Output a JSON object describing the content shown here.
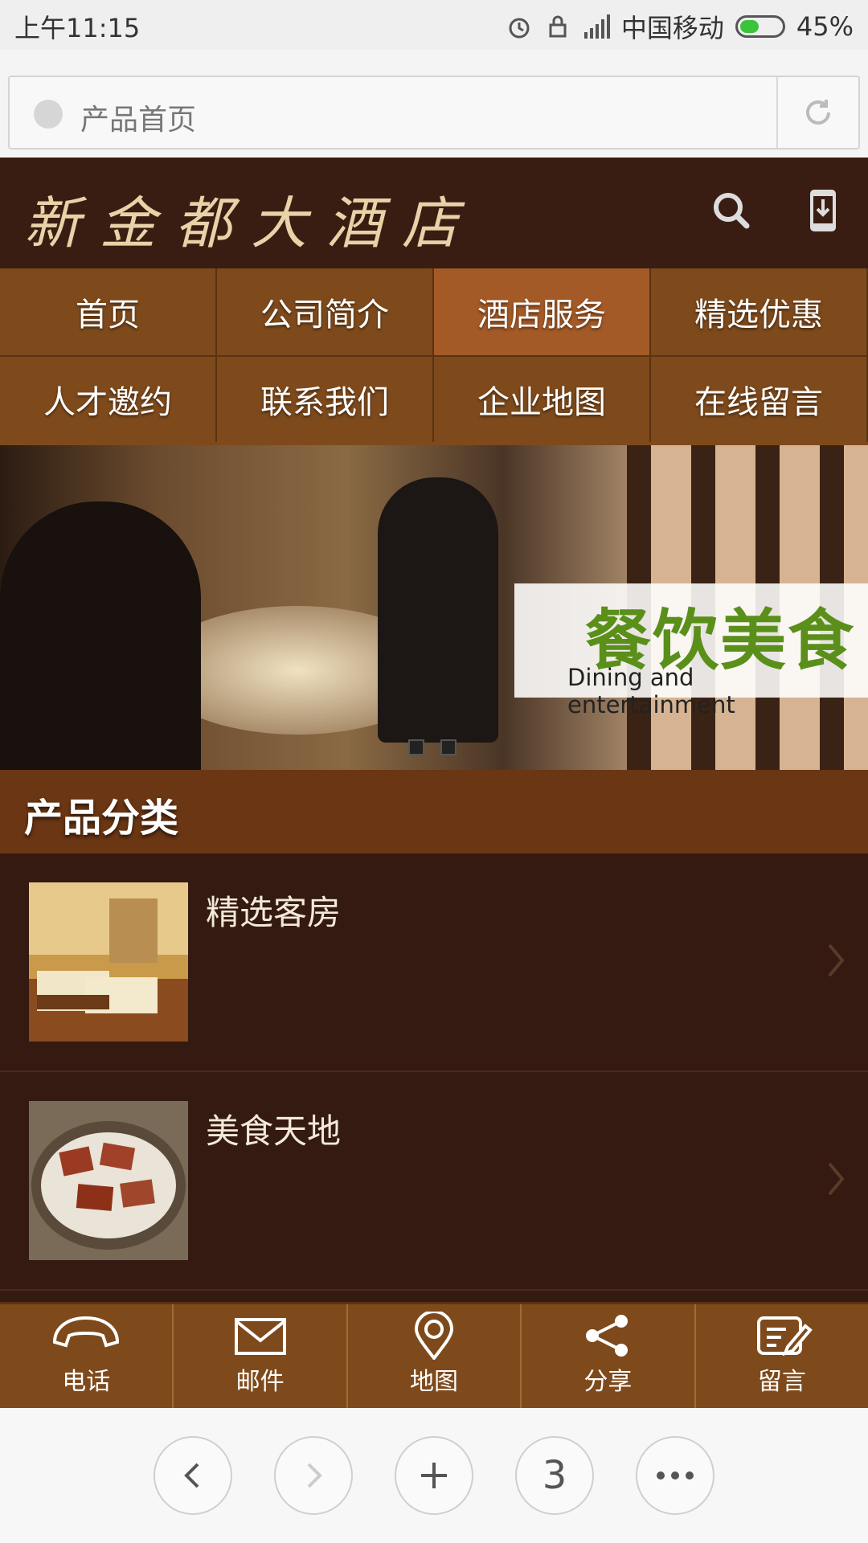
{
  "status": {
    "time": "上午11:15",
    "carrier": "中国移动",
    "battery": "45%",
    "battery_level": 0.45
  },
  "urlbar": {
    "text": "产品首页"
  },
  "header": {
    "logo": "新金都大酒店"
  },
  "menu": {
    "row1": [
      "首页",
      "公司简介",
      "酒店服务",
      "精选优惠"
    ],
    "row2": [
      "人才邀约",
      "联系我们",
      "企业地图",
      "在线留言"
    ],
    "active": "酒店服务"
  },
  "banner": {
    "title_cn": "餐饮美食",
    "title_en": "Dining and entertainment"
  },
  "section": {
    "title": "产品分类"
  },
  "products": [
    {
      "label": "精选客房",
      "icon": "hotel-room-photo"
    },
    {
      "label": "美食天地",
      "icon": "food-photo"
    }
  ],
  "tabbar": {
    "items": [
      {
        "label": "电话",
        "icon": "phone-icon"
      },
      {
        "label": "邮件",
        "icon": "mail-icon"
      },
      {
        "label": "地图",
        "icon": "map-pin-icon"
      },
      {
        "label": "分享",
        "icon": "share-icon"
      },
      {
        "label": "留言",
        "icon": "message-icon"
      }
    ]
  },
  "browser": {
    "tabs_count": "3"
  },
  "colors": {
    "header": "#3a1d12",
    "menu": "#7e4a1c",
    "active": "#a45a26",
    "section": "#6b3613",
    "list": "#341a10"
  }
}
